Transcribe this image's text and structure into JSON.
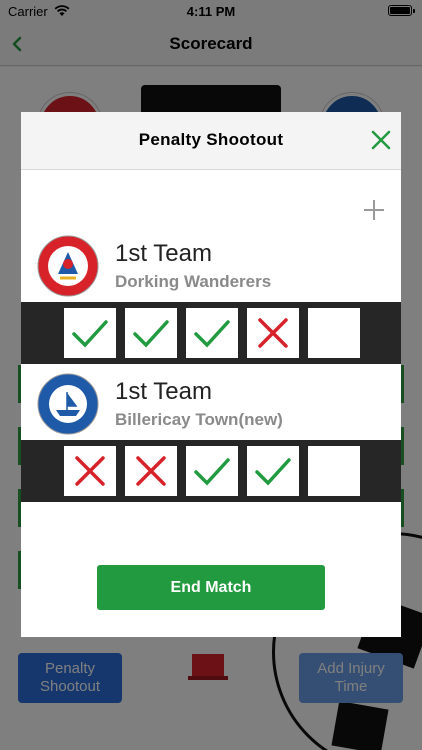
{
  "status_bar": {
    "carrier": "Carrier",
    "time": "4:11 PM"
  },
  "nav": {
    "title": "Scorecard"
  },
  "background": {
    "penalty_button": "Penalty Shootout",
    "injury_button": "Add Injury Time"
  },
  "modal": {
    "title": "Penalty Shootout",
    "end_match_label": "End Match",
    "teams": [
      {
        "team_name": "1st Team",
        "club_name": "Dorking Wanderers",
        "logo_text": "DORKING WANDERERS FC",
        "logo_color": "#d8222a",
        "kicks": [
          "scored",
          "scored",
          "scored",
          "missed",
          "empty"
        ]
      },
      {
        "team_name": "1st Team",
        "club_name": "Billericay Town(new)",
        "logo_text": "BILLERICAY TOWN F.C.",
        "logo_color": "#1f5aa8",
        "kicks": [
          "missed",
          "missed",
          "scored",
          "scored",
          "empty"
        ]
      }
    ]
  },
  "colors": {
    "accent_green": "#229a3f",
    "miss_red": "#d8222a",
    "strip": "#262626"
  }
}
